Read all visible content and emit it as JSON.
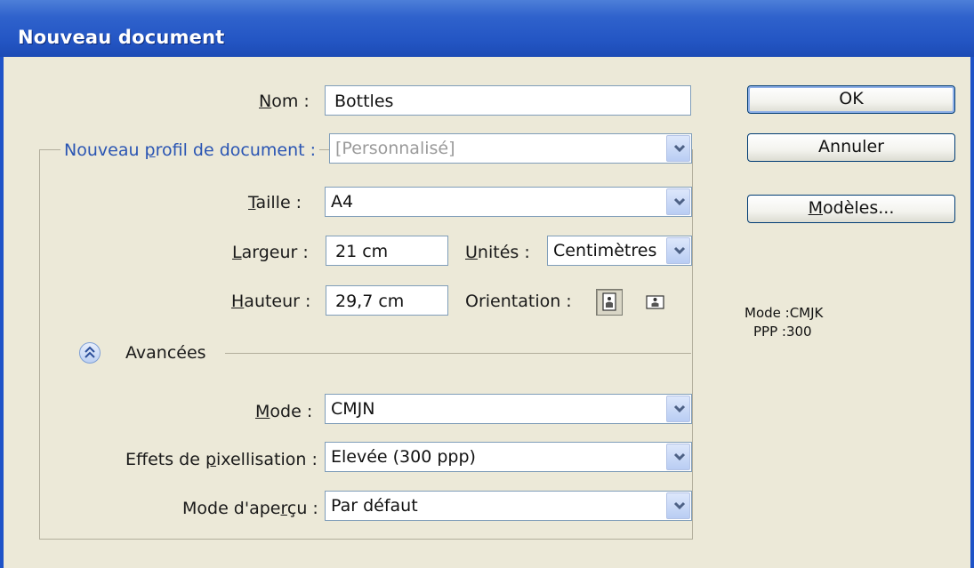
{
  "window": {
    "title": "Nouveau document"
  },
  "fields": {
    "nom": {
      "label": "Nom :",
      "value": "Bottles"
    },
    "profil": {
      "label": "Nouveau profil de document :",
      "value": "[Personnalisé]"
    },
    "taille": {
      "label": "Taille :",
      "value": "A4"
    },
    "largeur": {
      "label": "Largeur :",
      "value": "21 cm"
    },
    "unites": {
      "label": "Unités :",
      "value": "Centimètres"
    },
    "hauteur": {
      "label": "Hauteur :",
      "value": "29,7 cm"
    },
    "orientation": {
      "label": "Orientation :",
      "selected": "portrait"
    }
  },
  "advanced": {
    "label": "Avancées",
    "mode": {
      "label": "Mode :",
      "value": "CMJN"
    },
    "pixel_effects": {
      "label": "Effets de pixellisation :",
      "value": "Elevée (300 ppp)"
    },
    "preview_mode": {
      "label": "Mode d'aperçu :",
      "value": "Par défaut"
    }
  },
  "buttons": {
    "ok": "OK",
    "cancel": "Annuler",
    "templates": "Modèles..."
  },
  "info": {
    "mode_line": "Mode :CMJK",
    "ppp_line": "PPP :300"
  },
  "colors": {
    "title_bar": "#2456c4",
    "dialog_bg": "#ece9d8",
    "profile_label": "#2a55b3"
  }
}
